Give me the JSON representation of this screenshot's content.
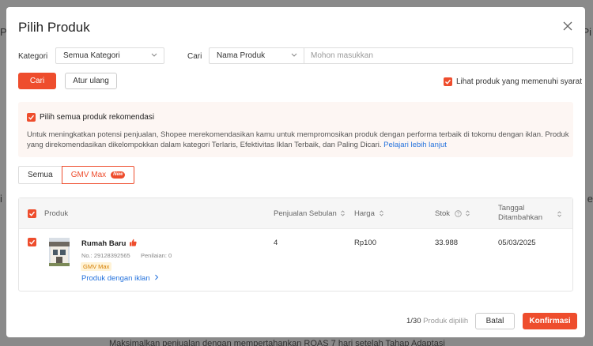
{
  "background": {
    "left_text": "Pe",
    "left_text2": "i",
    "right_text": "Pi",
    "right_text2": "e",
    "bottom_text": "Maksimalkan penjualan dengan mempertahankan ROAS 7 hari setelah Tahap Adaptasi"
  },
  "modal": {
    "title": "Pilih Produk",
    "close_icon": "close-icon"
  },
  "filters": {
    "category_label": "Kategori",
    "category_value": "Semua Kategori",
    "search_label": "Cari",
    "search_type_value": "Nama Produk",
    "search_placeholder": "Mohon masukkan",
    "search_button": "Cari",
    "reset_button": "Atur ulang",
    "eligible_label": "Lihat produk yang memenuhi syarat"
  },
  "promo": {
    "select_all_label": "Pilih semua produk rekomendasi",
    "description": "Untuk meningkatkan potensi penjualan, Shopee merekomendasikan kamu untuk mempromosikan produk dengan performa terbaik di tokomu dengan iklan. Produk yang direkomendasikan dikelompokkan dalam kategori Terlaris, Efektivitas Iklan Terbaik, dan Paling Dicari.",
    "link": "Pelajari lebih lanjut"
  },
  "tabs": [
    {
      "label": "Semua"
    },
    {
      "label": "GMV Max",
      "badge": "New"
    }
  ],
  "table": {
    "headers": {
      "product": "Produk",
      "monthly_sales": "Penjualan Sebulan",
      "price": "Harga",
      "stock": "Stok",
      "date_added": "Tanggal Ditambahkan"
    },
    "rows": [
      {
        "name": "Rumah Baru",
        "product_no": "No.: 29128392565",
        "rating": "Penilaian: 0",
        "tag": "GMV Max",
        "ad_link": "Produk dengan iklan",
        "monthly_sales": "4",
        "price": "Rp100",
        "stock": "33.988",
        "date_added": "05/03/2025"
      }
    ]
  },
  "footer": {
    "selected_count": "1/30",
    "selected_label": "Produk dipilih",
    "cancel_button": "Batal",
    "confirm_button": "Konfirmasi"
  },
  "colors": {
    "accent": "#ee4d2d",
    "link": "#2673dd"
  }
}
